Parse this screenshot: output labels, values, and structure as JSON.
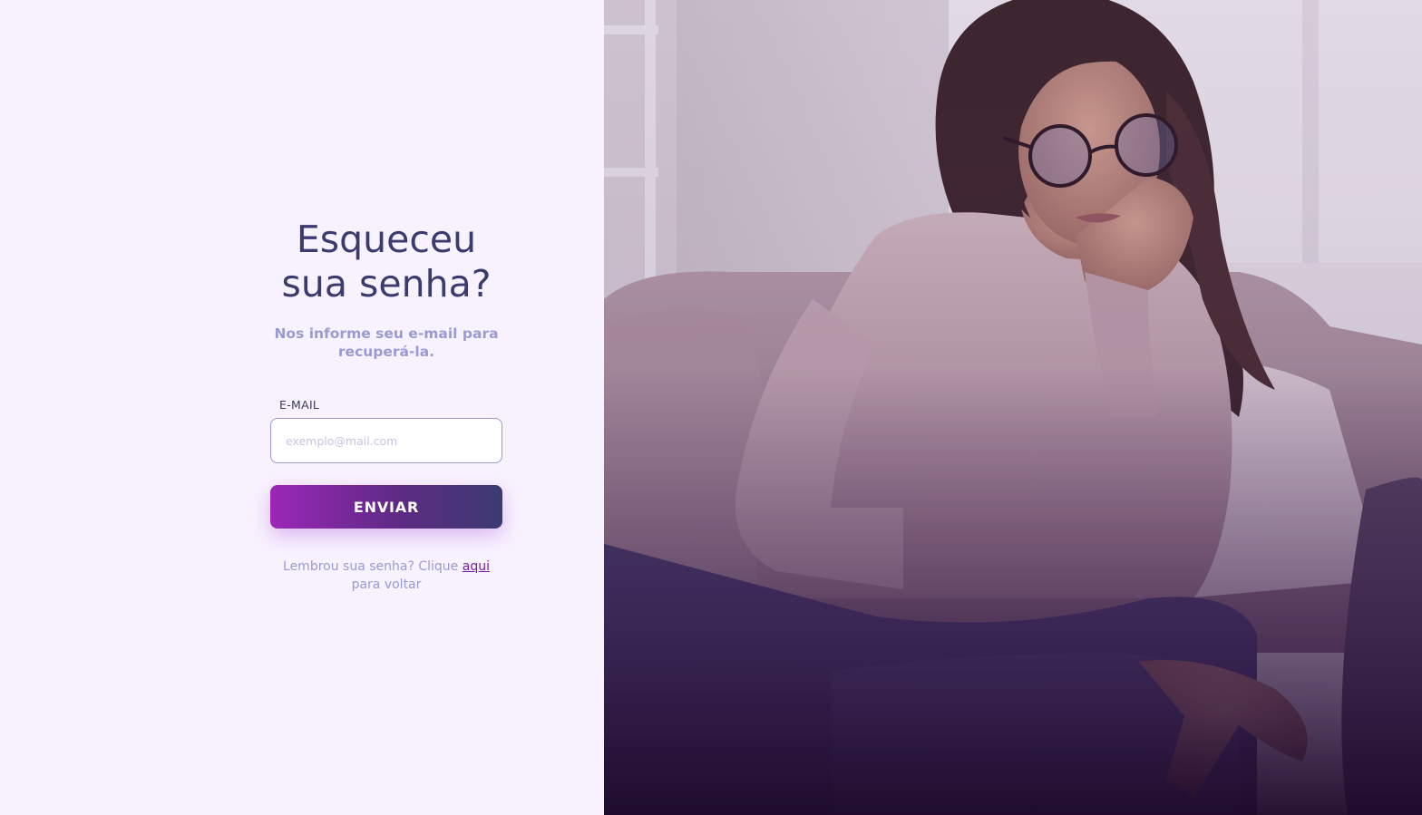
{
  "form": {
    "title_line1": "Esqueceu",
    "title_line2": "sua senha?",
    "subtitle_line1": "Nos informe seu e-mail para",
    "subtitle_line2": "recuperá-la.",
    "email_label": "E-MAIL",
    "email_placeholder": "exemplo@mail.com",
    "email_value": "",
    "submit_label": "ENVIAR",
    "back_text_prefix": "Lembrou sua senha? Clique",
    "back_link_label": "aqui",
    "back_text_suffix": "para voltar"
  },
  "hero": {
    "image_subject": "woman-with-glasses-on-sofa-with-laptop"
  },
  "colors": {
    "background": "#f8f2fe",
    "title": "#3b3b6e",
    "subtitle": "#9a9bd4",
    "button_gradient_start": "#9c27b8",
    "button_gradient_end": "#3b3b70",
    "link": "#7b1fa2"
  }
}
